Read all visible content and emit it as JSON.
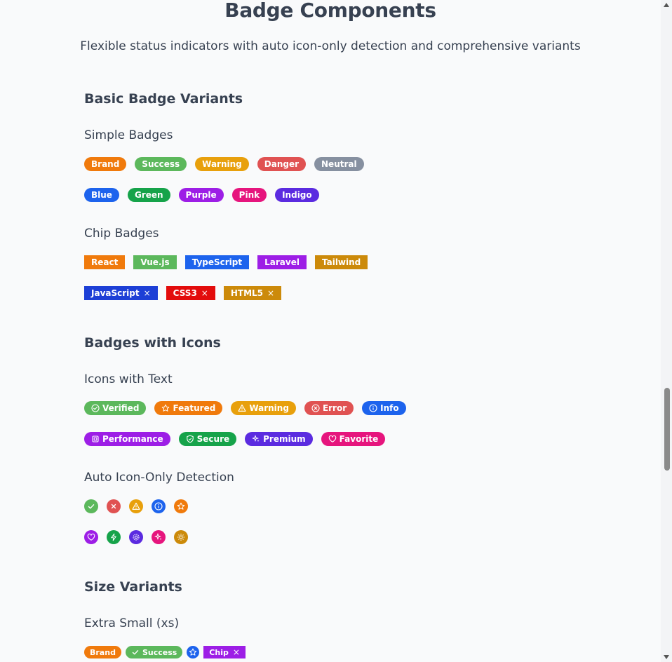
{
  "page": {
    "title": "Badge Components",
    "subtitle": "Flexible status indicators with auto icon-only detection and comprehensive variants"
  },
  "sections": {
    "basic": {
      "heading": "Basic Badge Variants",
      "simple_heading": "Simple Badges",
      "simple_row1": [
        {
          "label": "Brand",
          "color": "#f07a0c"
        },
        {
          "label": "Success",
          "color": "#5cb85c"
        },
        {
          "label": "Warning",
          "color": "#e8a00c"
        },
        {
          "label": "Danger",
          "color": "#e05252"
        },
        {
          "label": "Neutral",
          "color": "#8690a0"
        }
      ],
      "simple_row2": [
        {
          "label": "Blue",
          "color": "#1d63ed"
        },
        {
          "label": "Green",
          "color": "#16a34a"
        },
        {
          "label": "Purple",
          "color": "#9d1ee6"
        },
        {
          "label": "Pink",
          "color": "#e6157d"
        },
        {
          "label": "Indigo",
          "color": "#5b2be0"
        }
      ],
      "chip_heading": "Chip Badges",
      "chip_row1": [
        {
          "label": "React",
          "color": "#f07a0c"
        },
        {
          "label": "Vue.js",
          "color": "#5cb85c"
        },
        {
          "label": "TypeScript",
          "color": "#1d63ed"
        },
        {
          "label": "Laravel",
          "color": "#9d1ee6"
        },
        {
          "label": "Tailwind",
          "color": "#cc8a0a"
        }
      ],
      "chip_row2": [
        {
          "label": "JavaScript",
          "color": "#1d3fd6",
          "close": "×"
        },
        {
          "label": "CSS3",
          "color": "#e30c0c",
          "close": "×"
        },
        {
          "label": "HTML5",
          "color": "#cc8a0a",
          "close": "×"
        }
      ]
    },
    "icons": {
      "heading": "Badges with Icons",
      "text_heading": "Icons with Text",
      "text_row1": [
        {
          "label": "Verified",
          "color": "#5cb85c",
          "icon": "check-circle-icon"
        },
        {
          "label": "Featured",
          "color": "#f07a0c",
          "icon": "star-icon"
        },
        {
          "label": "Warning",
          "color": "#e8a00c",
          "icon": "warning-triangle-icon"
        },
        {
          "label": "Error",
          "color": "#e05252",
          "icon": "x-circle-icon"
        },
        {
          "label": "Info",
          "color": "#1d63ed",
          "icon": "info-circle-icon"
        }
      ],
      "text_row2": [
        {
          "label": "Performance",
          "color": "#9d1ee6",
          "icon": "cpu-icon"
        },
        {
          "label": "Secure",
          "color": "#16a34a",
          "icon": "shield-icon"
        },
        {
          "label": "Premium",
          "color": "#5b2be0",
          "icon": "sparkles-icon"
        },
        {
          "label": "Favorite",
          "color": "#e6157d",
          "icon": "heart-icon"
        }
      ],
      "auto_heading": "Auto Icon-Only Detection",
      "auto_row1": [
        {
          "color": "#5cb85c",
          "icon": "check-icon"
        },
        {
          "color": "#e05252",
          "icon": "x-icon"
        },
        {
          "color": "#e8a00c",
          "icon": "warning-triangle-icon"
        },
        {
          "color": "#1d63ed",
          "icon": "info-circle-icon"
        },
        {
          "color": "#f07a0c",
          "icon": "star-icon"
        }
      ],
      "auto_row2": [
        {
          "color": "#9d1ee6",
          "icon": "heart-icon"
        },
        {
          "color": "#16a34a",
          "icon": "bolt-icon"
        },
        {
          "color": "#5b2be0",
          "icon": "gear-icon"
        },
        {
          "color": "#e6157d",
          "icon": "sparkles-icon"
        },
        {
          "color": "#cc8a0a",
          "icon": "sun-icon"
        }
      ]
    },
    "sizes": {
      "heading": "Size Variants",
      "xs_heading": "Extra Small (xs)",
      "xs_row": {
        "brand": {
          "label": "Brand",
          "color": "#f07a0c"
        },
        "success": {
          "label": "Success",
          "color": "#5cb85c",
          "icon": "check-icon"
        },
        "star": {
          "color": "#1d63ed",
          "icon": "star-icon"
        },
        "chip": {
          "label": "Chip",
          "color": "#9d1ee6",
          "close": "×"
        }
      }
    }
  }
}
